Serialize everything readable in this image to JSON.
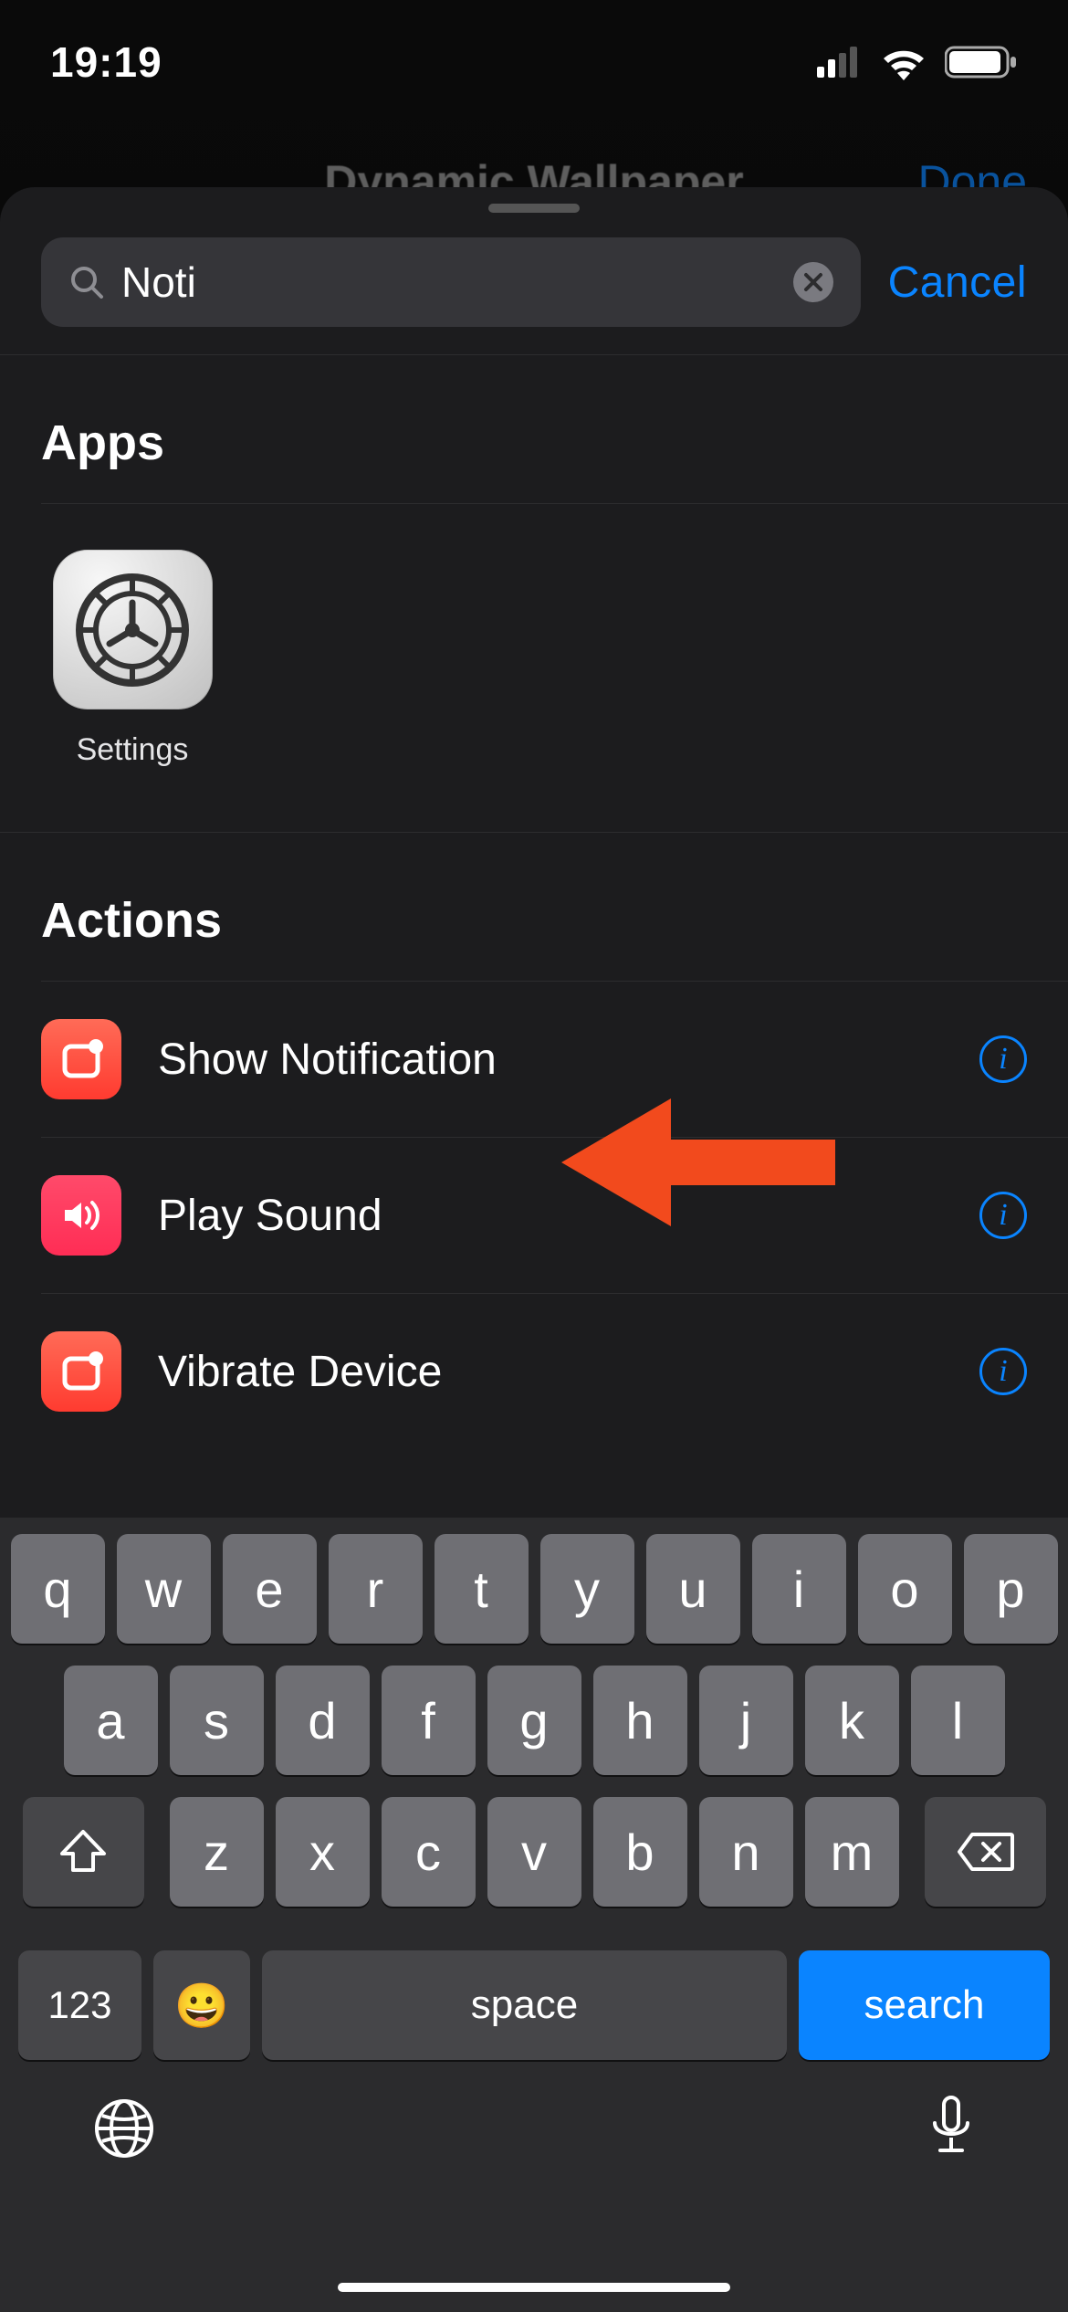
{
  "status_bar": {
    "time": "19:19"
  },
  "underlying": {
    "title": "Dynamic Wallpaper",
    "done": "Done"
  },
  "search": {
    "value": "Noti",
    "cancel": "Cancel"
  },
  "sections": {
    "apps_header": "Apps",
    "actions_header": "Actions"
  },
  "apps": [
    {
      "name": "Settings"
    }
  ],
  "actions": [
    {
      "label": "Show Notification",
      "icon": "notification"
    },
    {
      "label": "Play Sound",
      "icon": "sound"
    },
    {
      "label": "Vibrate Device",
      "icon": "notification"
    }
  ],
  "keyboard": {
    "row1": [
      "q",
      "w",
      "e",
      "r",
      "t",
      "y",
      "u",
      "i",
      "o",
      "p"
    ],
    "row2": [
      "a",
      "s",
      "d",
      "f",
      "g",
      "h",
      "j",
      "k",
      "l"
    ],
    "row3": [
      "z",
      "x",
      "c",
      "v",
      "b",
      "n",
      "m"
    ],
    "numbers_label": "123",
    "space_label": "space",
    "search_label": "search"
  }
}
